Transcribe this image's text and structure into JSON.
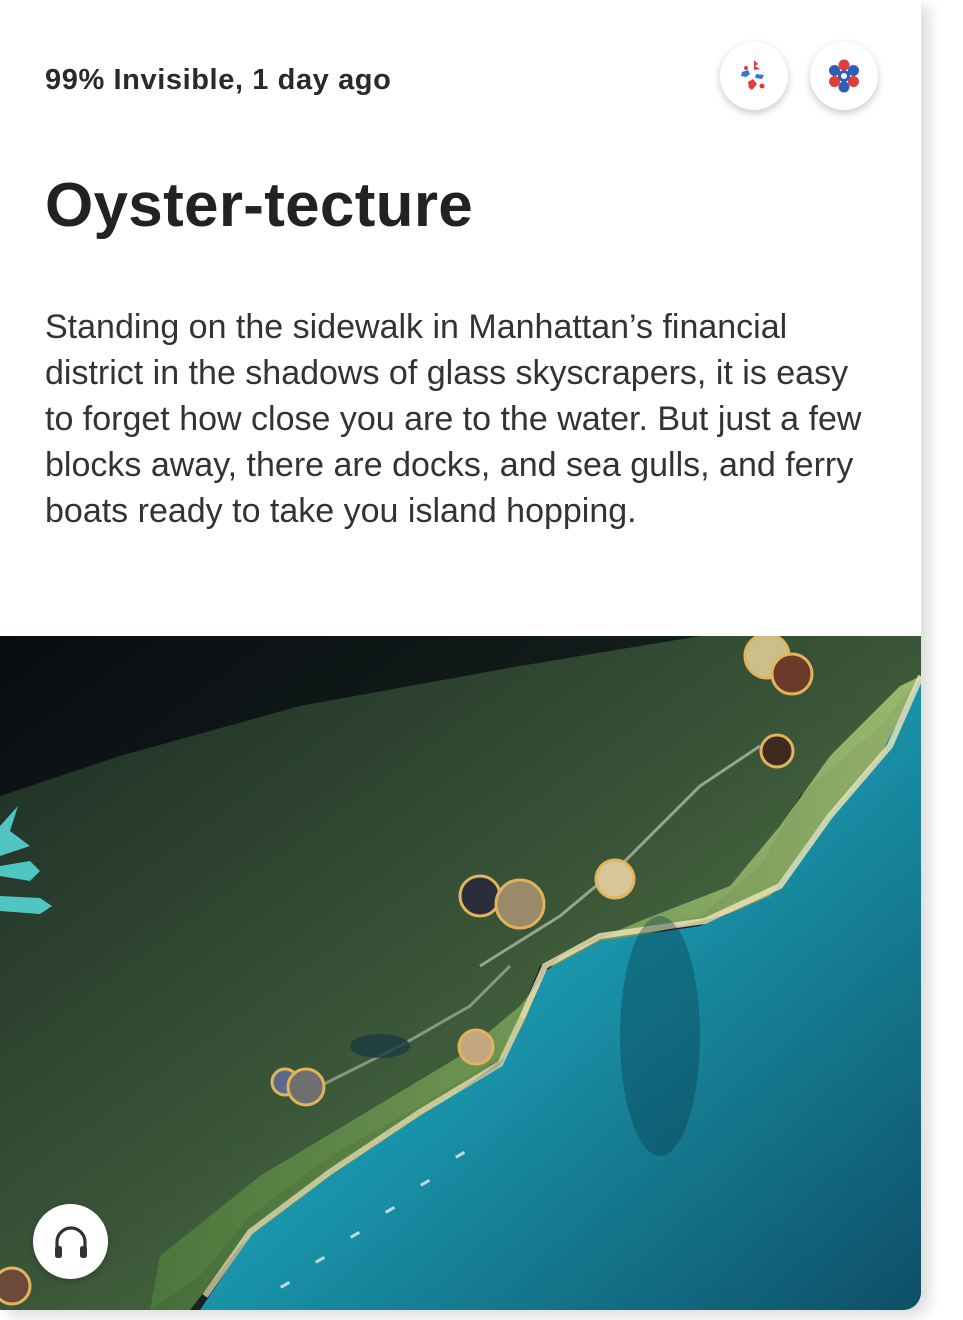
{
  "episode": {
    "source": "99% Invisible",
    "age": "1 day ago",
    "meta_line": "99% Invisible, 1 day ago",
    "title": "Oyster-tecture",
    "summary": "Standing on the sidewalk in Manhattan’s financial district in the shadows of glass skyscrapers, it is easy to forget how close you are to the water. But just a few blocks away, there are docks, and sea gulls, and ferry boats ready to take you island hopping."
  },
  "avatars": [
    {
      "icon": "red-blue-figures-icon"
    },
    {
      "icon": "red-blue-flower-icon"
    }
  ],
  "hero_image": {
    "icon": "coastal-map-illustration"
  },
  "listen_button": {
    "icon": "headphones-icon"
  }
}
